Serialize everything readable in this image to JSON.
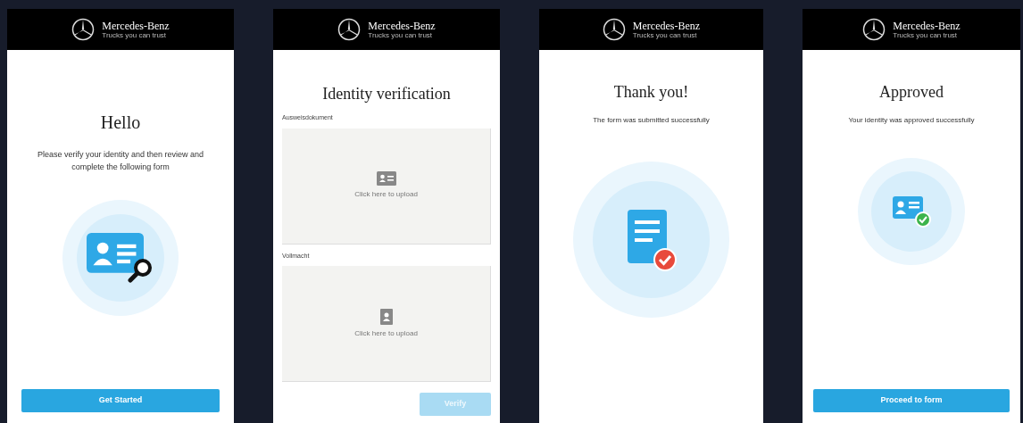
{
  "screens": [
    {
      "kind": "intro",
      "brand": {
        "name": "Mercedes-Benz",
        "tagline": "Trucks you can trust"
      },
      "title": "Hello",
      "message": "Please verify your identity and then review and complete the following form",
      "button": {
        "label": "Get Started",
        "disabled": false
      }
    },
    {
      "kind": "upload",
      "brand": {
        "name": "Mercedes-Benz",
        "tagline": "Trucks you can trust"
      },
      "title": "Identity verification",
      "uploads": [
        {
          "label": "Ausweisdokument",
          "hint": "Click here to upload",
          "kind": "card"
        },
        {
          "label": "Vollmacht",
          "hint": "Click here to upload",
          "kind": "portrait"
        }
      ],
      "button": {
        "label": "Verify",
        "disabled": true
      }
    },
    {
      "kind": "success",
      "brand": {
        "name": "Mercedes-Benz",
        "tagline": "Trucks you can trust"
      },
      "title": "Thank you!",
      "message": "The form was submitted successfully"
    },
    {
      "kind": "approved",
      "brand": {
        "name": "Mercedes-Benz",
        "tagline": "Trucks you can trust"
      },
      "title": "Approved",
      "message": "Your identity was approved successfully",
      "button": {
        "label": "Proceed to form",
        "disabled": false
      }
    }
  ]
}
